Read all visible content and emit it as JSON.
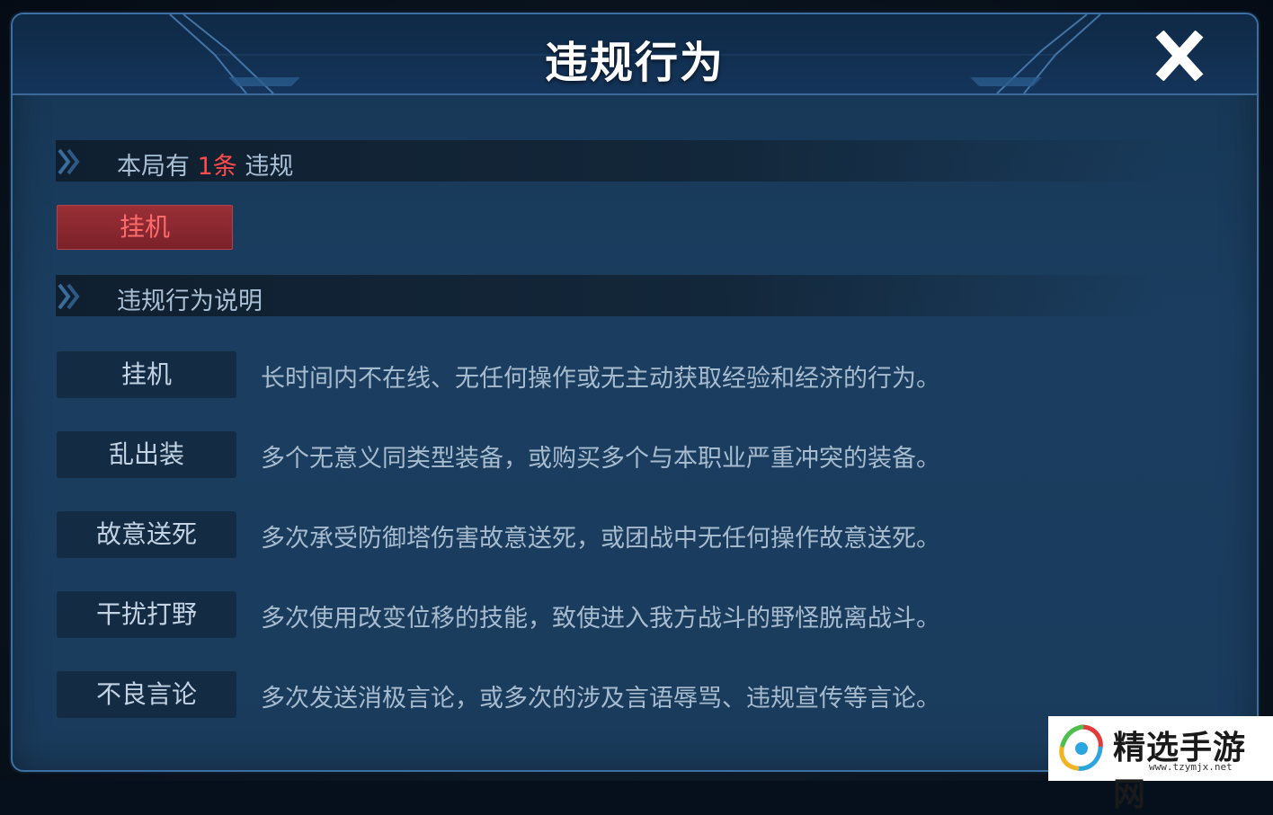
{
  "dialog": {
    "title": "违规行为"
  },
  "summary": {
    "prefix": "本局有",
    "count": "1条",
    "suffix": "违规"
  },
  "active_violation": "挂机",
  "rules_section": {
    "title": "违规行为说明"
  },
  "rules": [
    {
      "name": "挂机",
      "description": "长时间内不在线、无任何操作或无主动获取经验和经济的行为。"
    },
    {
      "name": "乱出装",
      "description": "多个无意义同类型装备，或购买多个与本职业严重冲突的装备。"
    },
    {
      "name": "故意送死",
      "description": "多次承受防御塔伤害故意送死，或团战中无任何操作故意送死。"
    },
    {
      "name": "干扰打野",
      "description": "多次使用改变位移的技能，致使进入我方战斗的野怪脱离战斗。"
    },
    {
      "name": "不良言论",
      "description": "多次发送消极言论，或多次的涉及言语辱骂、违规宣传等言论。"
    }
  ],
  "watermark": {
    "site_name": "精选手游网",
    "url": "www.tzymjx.net"
  },
  "colors": {
    "panel": "#1a3b5c",
    "border": "#3e6fa3",
    "highlight_red": "#ff4a4a",
    "active_chip": "#8a2830"
  },
  "icons": {
    "close": "close-x-icon",
    "section": "double-chevron-icon"
  }
}
